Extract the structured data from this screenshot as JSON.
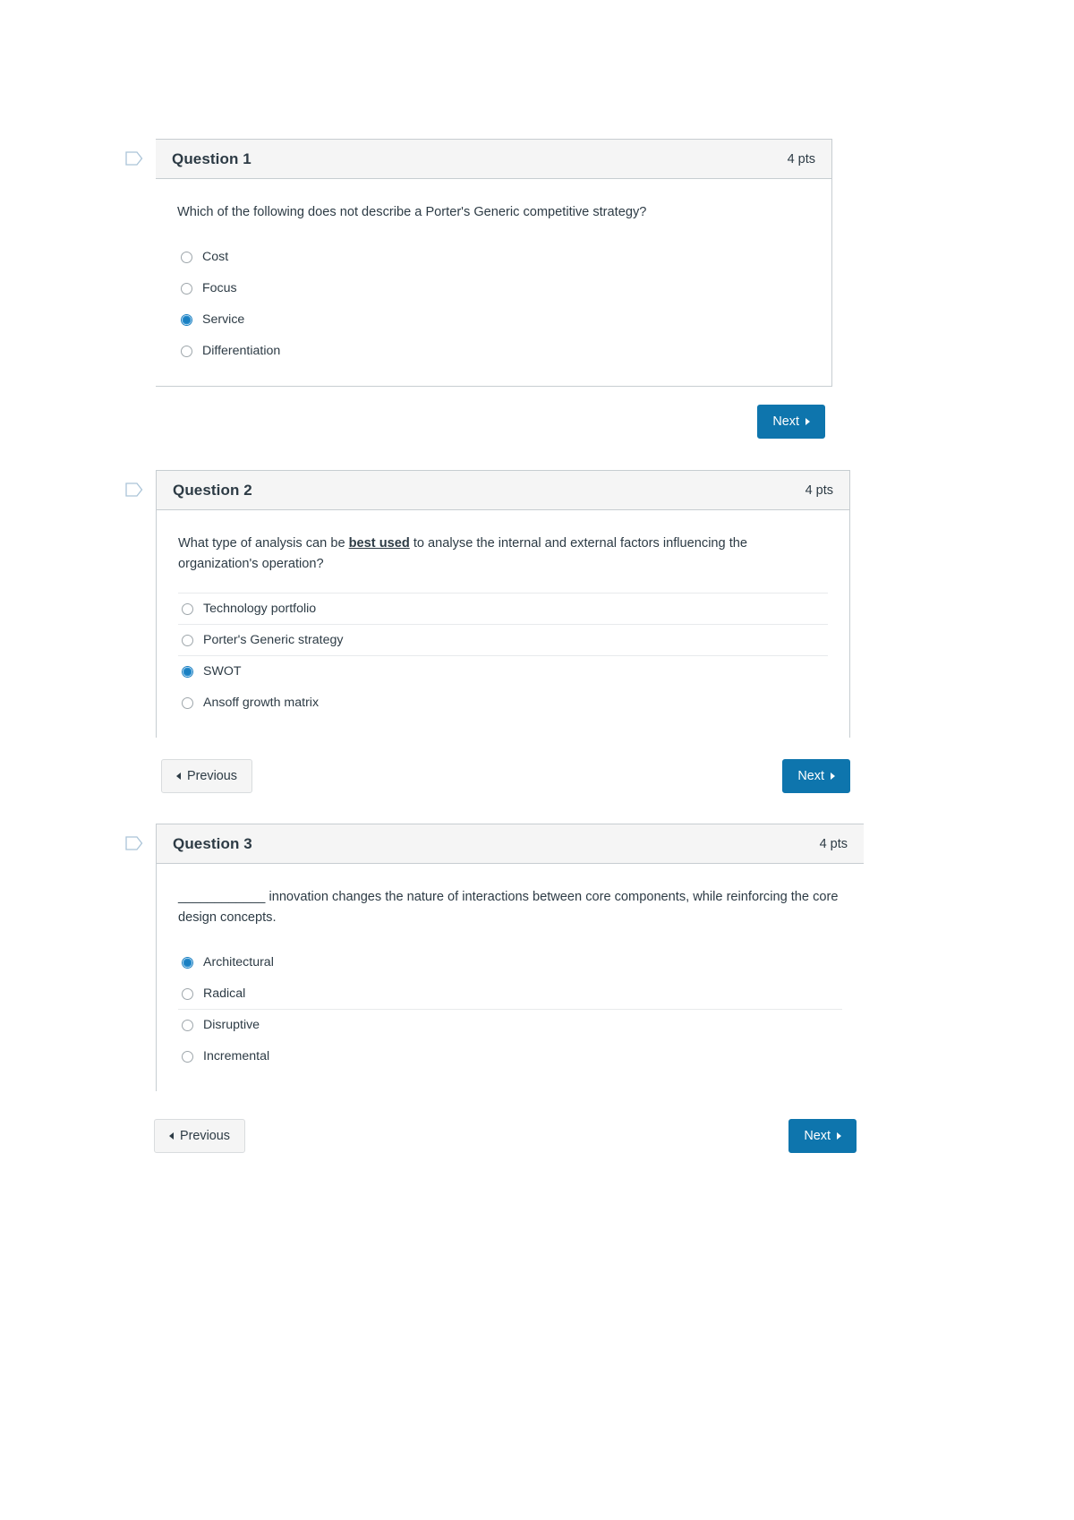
{
  "colors": {
    "accent_blue": "#0e75ad",
    "radio_selected": "#1a7fc1",
    "header_bg": "#f5f5f5",
    "border": "#c7cdd1",
    "text": "#2d3b45"
  },
  "questions": [
    {
      "title": "Question 1",
      "points": "4 pts",
      "flag_icon": "flag-outline-icon",
      "prompt": "Which of the following does not describe a Porter's Generic competitive strategy?",
      "answers": [
        {
          "label": "Cost",
          "selected": false
        },
        {
          "label": "Focus",
          "selected": false
        },
        {
          "label": "Service",
          "selected": true
        },
        {
          "label": "Differentiation",
          "selected": false
        }
      ]
    },
    {
      "title": "Question 2",
      "points": "4 pts",
      "flag_icon": "flag-outline-icon",
      "prompt_part1": "What type of analysis can be ",
      "prompt_emphasis": "best used",
      "prompt_part2": " to analyse the internal and external factors influencing the organization's operation?",
      "answers": [
        {
          "label": "Technology portfolio",
          "selected": false
        },
        {
          "label": "Porter's Generic strategy",
          "selected": false
        },
        {
          "label": "SWOT",
          "selected": true
        },
        {
          "label": "Ansoff growth matrix",
          "selected": false
        }
      ]
    },
    {
      "title": "Question 3",
      "points": "4 pts",
      "flag_icon": "flag-outline-icon",
      "prompt_blank": "____________",
      "prompt_rest": " innovation changes the nature of interactions between core components, while reinforcing the core design concepts.",
      "answers": [
        {
          "label": "Architectural",
          "selected": true
        },
        {
          "label": "Radical",
          "selected": false
        },
        {
          "label": "Disruptive",
          "selected": false
        },
        {
          "label": "Incremental",
          "selected": false
        }
      ]
    }
  ],
  "nav": {
    "next_label": "Next",
    "previous_label": "Previous",
    "next_icon": "arrow-right-icon",
    "previous_icon": "arrow-left-icon"
  }
}
